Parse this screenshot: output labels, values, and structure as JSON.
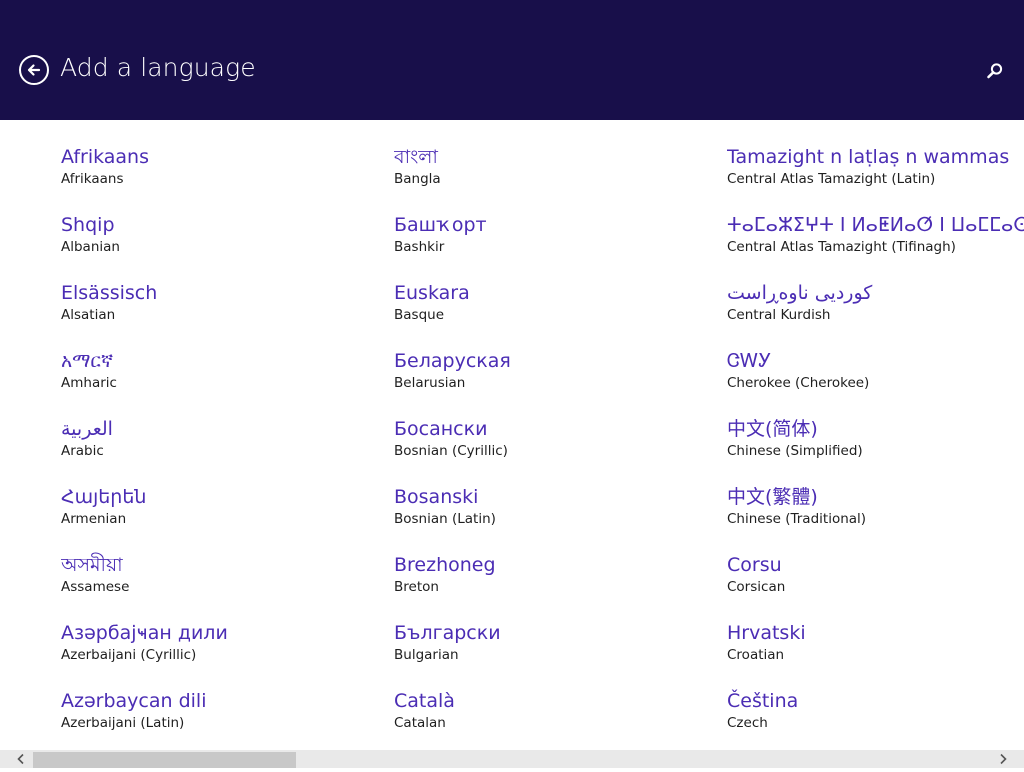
{
  "header": {
    "title": "Add a language",
    "background_color": "#180f4a"
  },
  "icons": {
    "back": "back-arrow-circle-icon",
    "search": "search-icon",
    "scroll_left": "chevron-left-icon",
    "scroll_right": "chevron-right-icon"
  },
  "accent_color": "#4b2db4",
  "columns": [
    {
      "items": [
        {
          "native": "Afrikaans",
          "english": "Afrikaans"
        },
        {
          "native": "Shqip",
          "english": "Albanian"
        },
        {
          "native": "Elsässisch",
          "english": "Alsatian"
        },
        {
          "native": "አማርኛ",
          "english": "Amharic"
        },
        {
          "native": "العربية",
          "english": "Arabic"
        },
        {
          "native": "Հայերեն",
          "english": "Armenian"
        },
        {
          "native": "অসমীয়া",
          "english": "Assamese"
        },
        {
          "native": "Азәрбајҹан дили",
          "english": "Azerbaijani (Cyrillic)"
        },
        {
          "native": "Azərbaycan dili",
          "english": "Azerbaijani (Latin)"
        }
      ]
    },
    {
      "items": [
        {
          "native": "বাংলা",
          "english": "Bangla"
        },
        {
          "native": "Башҡорт",
          "english": "Bashkir"
        },
        {
          "native": "Euskara",
          "english": "Basque"
        },
        {
          "native": "Беларуская",
          "english": "Belarusian"
        },
        {
          "native": "Босански",
          "english": "Bosnian (Cyrillic)"
        },
        {
          "native": "Bosanski",
          "english": "Bosnian (Latin)"
        },
        {
          "native": "Brezhoneg",
          "english": "Breton"
        },
        {
          "native": "Български",
          "english": "Bulgarian"
        },
        {
          "native": "Català",
          "english": "Catalan"
        }
      ]
    },
    {
      "items": [
        {
          "native": "Tamazight n laṭlaṣ n wammas",
          "english": "Central Atlas Tamazight (Latin)"
        },
        {
          "native": "ⵜⴰⵎⴰⵣⵉⵖⵜ ⵏ ⵍⴰⵟⵍⴰⵚ ⵏ ⵡⴰⵎⵎⴰⵙ",
          "english": "Central Atlas Tamazight (Tifinagh)"
        },
        {
          "native": "کوردیی ناوەڕاست",
          "english": "Central Kurdish"
        },
        {
          "native": "ᏣᎳᎩ",
          "english": "Cherokee (Cherokee)"
        },
        {
          "native": "中文(简体)",
          "english": "Chinese (Simplified)"
        },
        {
          "native": "中文(繁體)",
          "english": "Chinese (Traditional)"
        },
        {
          "native": "Corsu",
          "english": "Corsican"
        },
        {
          "native": "Hrvatski",
          "english": "Croatian"
        },
        {
          "native": "Čeština",
          "english": "Czech"
        }
      ]
    }
  ]
}
